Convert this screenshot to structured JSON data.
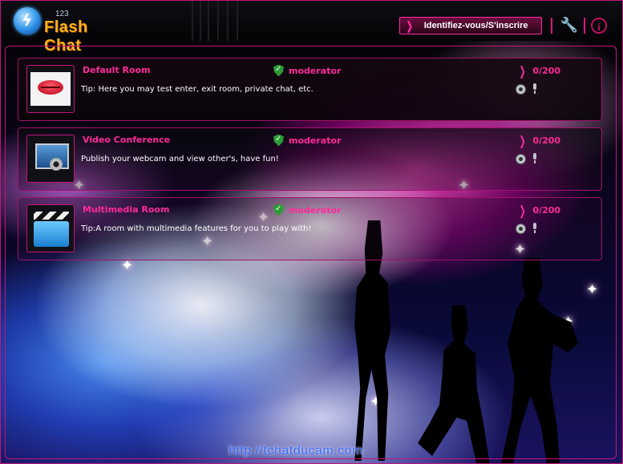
{
  "header": {
    "logo": {
      "number": "123",
      "text": "Flash Chat"
    },
    "login_button_label": "Identifiez-vous/S'inscrire",
    "tools_icon": "wrench-icon",
    "info_icon": "info-icon",
    "info_glyph": "i"
  },
  "rooms": [
    {
      "name": "Default Room",
      "tip": "Tip: Here you may test enter, exit room, private chat, etc.",
      "role": "moderator",
      "count": "0/200",
      "icon": "lips-icon"
    },
    {
      "name": "Video Conference",
      "tip": "Publish your webcam and view other's, have fun!",
      "role": "moderator",
      "count": "0/200",
      "icon": "webcam-monitor-icon"
    },
    {
      "name": "Multimedia Room",
      "tip": "Tip:A room with multimedia features for you to play with!",
      "role": "moderator",
      "count": "0/200",
      "icon": "clapperboard-icon"
    }
  ],
  "footer": {
    "url": "http://tchatducam.com"
  },
  "colors": {
    "accent": "#ff2a9a",
    "border": "#c2147a",
    "logo": "#ffb21c",
    "url": "#3a6cff"
  }
}
